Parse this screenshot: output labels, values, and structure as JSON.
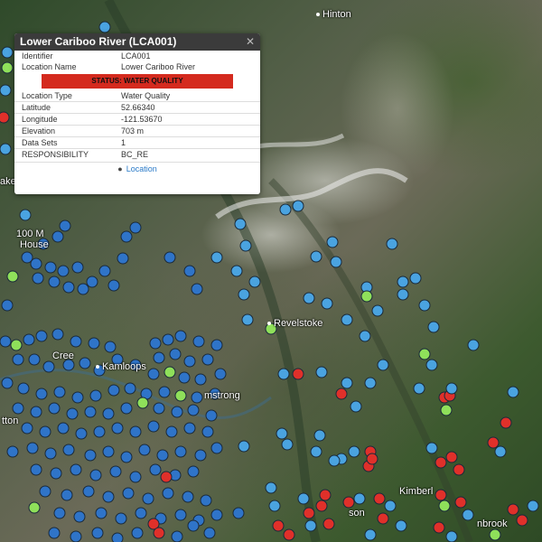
{
  "map": {
    "places": [
      {
        "name": "Hinton",
        "dot": true
      },
      {
        "name": "100 M",
        "dot": false
      },
      {
        "name": "House",
        "dot": false
      },
      {
        "name": "Cree",
        "dot": false
      },
      {
        "name": "Kamloops",
        "dot": true
      },
      {
        "name": "mstrong",
        "dot": false
      },
      {
        "name": "Revelstoke",
        "dot": true
      },
      {
        "name": "Kimberl",
        "dot": false
      },
      {
        "name": "nbrook",
        "dot": false
      },
      {
        "name": "tton",
        "dot": false
      },
      {
        "name": "son",
        "dot": false
      },
      {
        "name": "akes",
        "dot": false
      }
    ],
    "marker_colors": {
      "blue": "#2f74c8",
      "lightblue": "#4aa3e0",
      "green": "#8fe05a",
      "red": "#e0302a"
    }
  },
  "popup": {
    "title": "Lower Cariboo River (LCA001)",
    "close": "✕",
    "rows_top": [
      {
        "label": "Identifier",
        "value": "LCA001"
      },
      {
        "label": "Location Name",
        "value": "Lower Cariboo River"
      }
    ],
    "status": "STATUS: WATER QUALITY",
    "rows_bottom": [
      {
        "label": "Location Type",
        "value": "Water Quality"
      },
      {
        "label": "Latitude",
        "value": "52.66340"
      },
      {
        "label": "Longitude",
        "value": "-121.53670"
      },
      {
        "label": "Elevation",
        "value": "703 m"
      },
      {
        "label": "Data Sets",
        "value": "1"
      },
      {
        "label": "RESPONSIBILITY",
        "value": "BC_RE"
      }
    ],
    "footer_icon": "map-pin-icon",
    "footer_link": "Location"
  }
}
